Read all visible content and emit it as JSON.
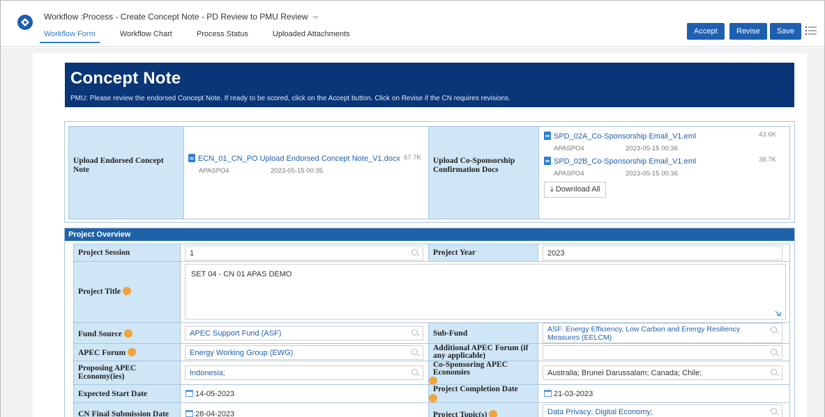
{
  "header": {
    "title": "Workflow :Process - Create Concept Note - PD Review to PMU Review",
    "tabs": [
      "Workflow Form",
      "Workflow Chart",
      "Process Status",
      "Uploaded Attachments"
    ],
    "buttons": {
      "accept": "Accept",
      "revise": "Revise",
      "save": "Save"
    }
  },
  "banner": {
    "title": "Concept Note",
    "instructions": "PMU: Please review the endorsed Concept Note. If ready to be scored, click on the Accept button. Click on Revise if the CN requires revisions."
  },
  "uploads": {
    "endorsed": {
      "label": "Upload Endorsed Concept Note",
      "file": {
        "name": "ECN_01_CN_PO Upload Endorsed Concept Note_V1.docx",
        "size": "67.7K",
        "user": "APASPO4",
        "date": "2023-05-15 00:35"
      }
    },
    "cosponsorship": {
      "label": "Upload Co-Sponsorship Confirmation Docs",
      "files": [
        {
          "name": "SPD_02A_Co-Sponsorship Email_V1.eml",
          "size": "43.6K",
          "user": "APASPO4",
          "date": "2023-05-15 00:36"
        },
        {
          "name": "SPD_02B_Co-Sponsorship Email_V1.eml",
          "size": "38.7K",
          "user": "APASPO4",
          "date": "2023-05-15 00:36"
        }
      ],
      "download_all": "Download All"
    }
  },
  "overview": {
    "heading": "Project Overview",
    "project_session_label": "Project Session",
    "project_session": "1",
    "project_year_label": "Project Year",
    "project_year": "2023",
    "project_title_label": "Project Title",
    "project_title": "SET 04 - CN 01 APAS DEMO",
    "fund_source_label": "Fund Source",
    "fund_source": "APEC Support Fund (ASF)",
    "sub_fund_label": "Sub-Fund",
    "sub_fund": "ASF: Energy Efficiency, Low Carbon and Energy Resiliency Measures (EELCM)",
    "apec_forum_label": "APEC Forum",
    "apec_forum": "Energy Working Group (EWG)",
    "additional_forum_label": "Additional APEC Forum (if any applicable)",
    "additional_forum": "",
    "proposing_label": "Proposing APEC Economy(ies)",
    "proposing": "Indonesia;",
    "cosponsoring_label": "Co-Sponsoring APEC Economies",
    "cosponsoring": "Australia;  Brunei Darussalam;  Canada;  Chile;",
    "start_date_label": "Expected Start Date",
    "start_date": "14-05-2023",
    "completion_date_label": "Project Completion Date",
    "completion_date": "21-03-2023",
    "cn_submission_label": "CN Final Submission Date",
    "cn_submission": "28-04-2023",
    "topics_label": "Project Topic(s)",
    "topics": "Data Privacy;  Digital Economy;"
  },
  "colors": {
    "navy": "#0a3577",
    "primary": "#1e5fb1",
    "label_bg": "#cfe6f7",
    "help": "#f2a33a"
  },
  "icons": [
    "edit-icon",
    "list-menu-icon",
    "document-icon",
    "download-icon",
    "help-icon",
    "lookup-icon",
    "calendar-icon",
    "resize-icon"
  ]
}
